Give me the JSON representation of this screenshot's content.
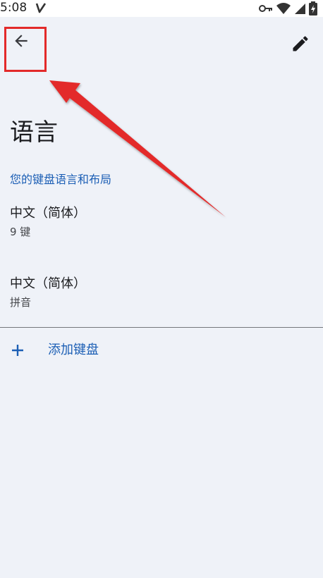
{
  "status_bar": {
    "time": "5:08",
    "icons": [
      "v-check-icon",
      "key-icon",
      "wifi-icon",
      "signal-icon",
      "battery-charging-icon"
    ]
  },
  "toolbar": {
    "back_icon": "arrow-left-icon",
    "edit_icon": "pencil-icon"
  },
  "page": {
    "title": "语言",
    "section_header": "您的键盘语言和布局"
  },
  "languages": [
    {
      "title": "中文（简体）",
      "subtitle": "9 键"
    },
    {
      "title": "中文（简体）",
      "subtitle": "拼音"
    }
  ],
  "add_keyboard": {
    "label": "添加键盘",
    "icon": "plus-icon"
  },
  "colors": {
    "accent": "#1c5fb5",
    "background": "#eff2f8",
    "annotation": "#e32a2a"
  }
}
